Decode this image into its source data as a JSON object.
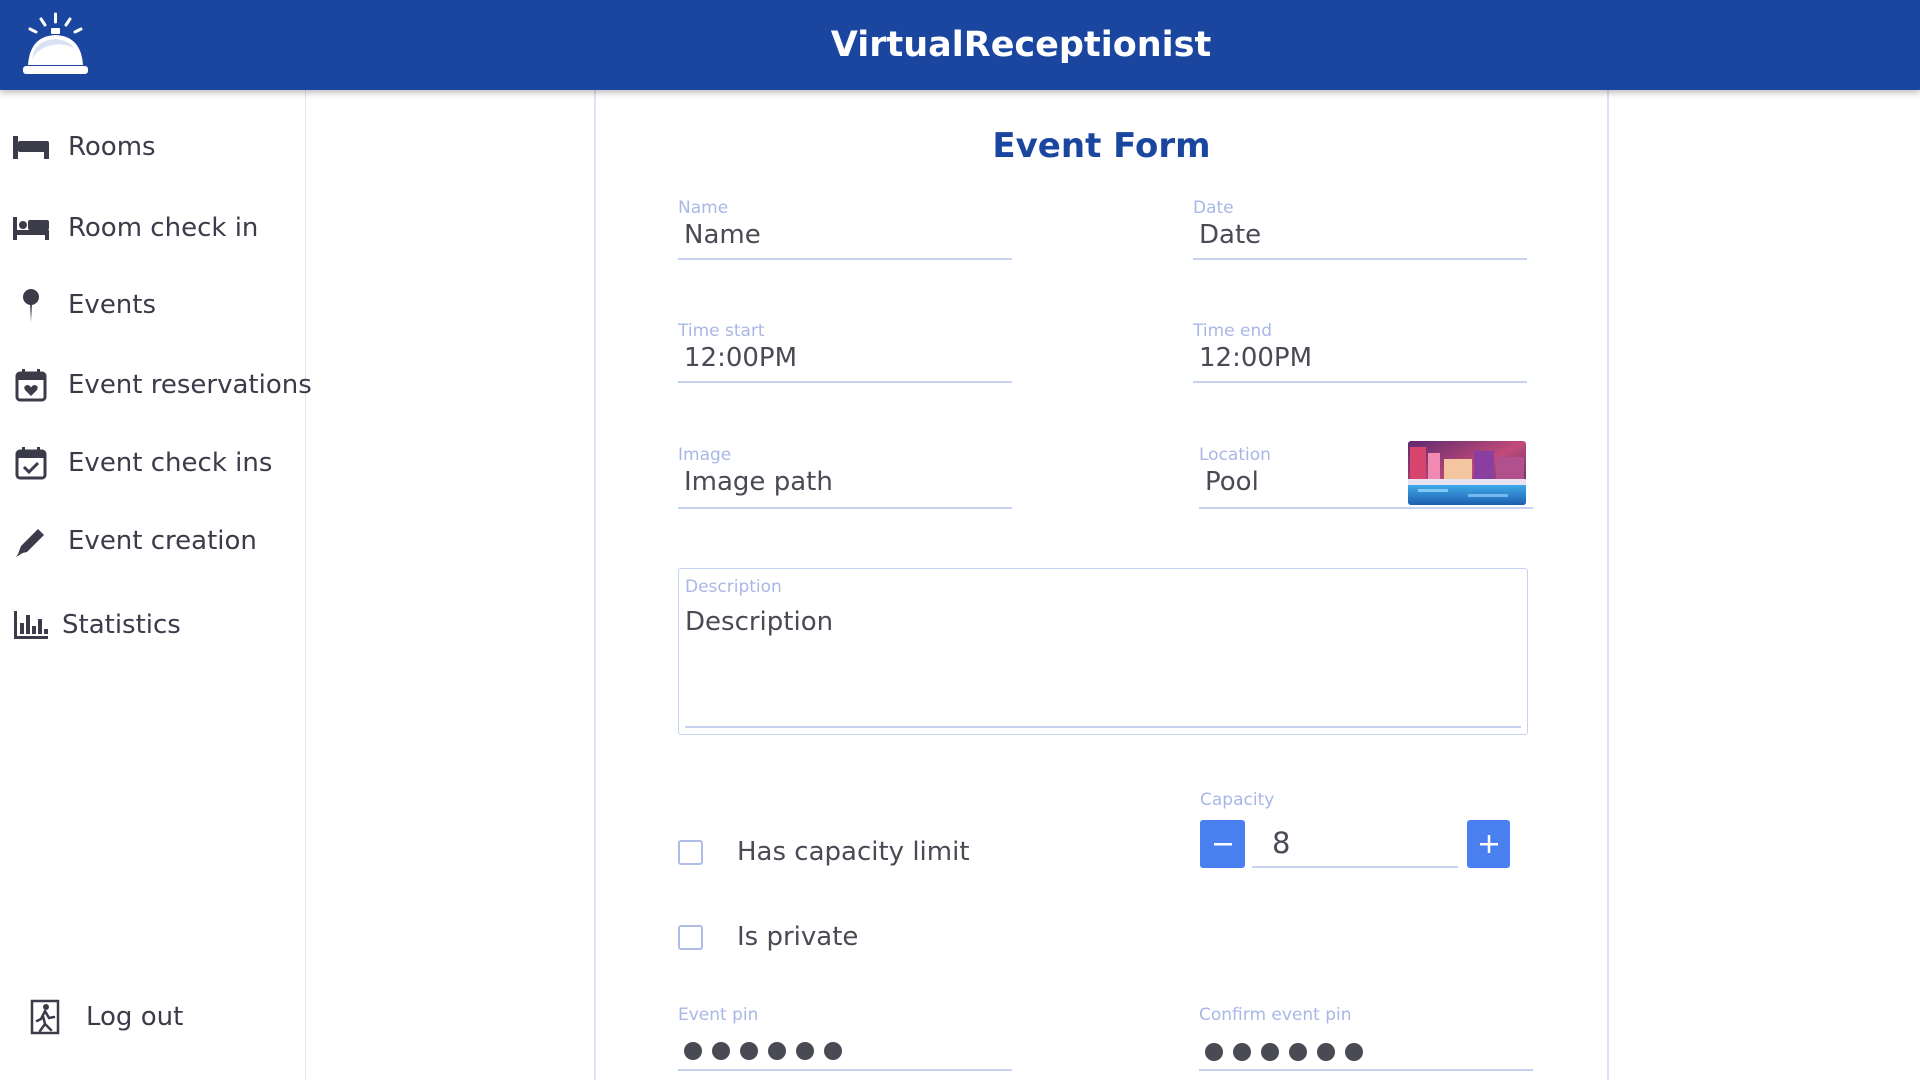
{
  "app": {
    "title": "VirtualReceptionist",
    "logo_icon": "reception-bell-icon",
    "brand_color": "#1a46a0",
    "accent_color": "#4a7ff0"
  },
  "sidebar": {
    "items": [
      {
        "label": "Rooms",
        "icon": "bed-icon"
      },
      {
        "label": "Room check in",
        "icon": "bed-person-icon"
      },
      {
        "label": "Events",
        "icon": "pin-icon"
      },
      {
        "label": "Event reservations",
        "icon": "calendar-heart-icon"
      },
      {
        "label": "Event check ins",
        "icon": "calendar-check-icon"
      },
      {
        "label": "Event creation",
        "icon": "pencil-icon"
      },
      {
        "label": "Statistics",
        "icon": "bar-chart-icon"
      }
    ],
    "logout": {
      "label": "Log out",
      "icon": "exit-icon"
    }
  },
  "form": {
    "title": "Event Form",
    "name": {
      "label": "Name",
      "value": "Name"
    },
    "date": {
      "label": "Date",
      "value": "Date"
    },
    "time_start": {
      "label": "Time start",
      "value": "12:00PM"
    },
    "time_end": {
      "label": "Time end",
      "value": "12:00PM"
    },
    "image": {
      "label": "Image",
      "value": "Image path"
    },
    "location": {
      "label": "Location",
      "value": "Pool"
    },
    "description": {
      "label": "Description",
      "value": "Description"
    },
    "has_capacity_limit": {
      "label": "Has capacity limit",
      "checked": false
    },
    "is_private": {
      "label": "Is private",
      "checked": false
    },
    "capacity": {
      "label": "Capacity",
      "value": "8"
    },
    "event_pin": {
      "label": "Event pin",
      "masked_length": 6
    },
    "confirm_event_pin": {
      "label": "Confirm event pin",
      "masked_length": 6
    }
  }
}
